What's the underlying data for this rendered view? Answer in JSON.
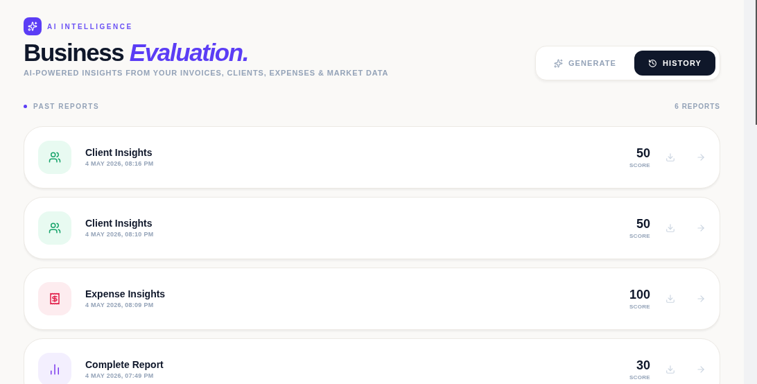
{
  "header": {
    "eyebrow": "AI INTELLIGENCE",
    "title": "Business",
    "title_accent": "Evaluation.",
    "subtitle": "AI-POWERED INSIGHTS FROM YOUR INVOICES, CLIENTS, EXPENSES & MARKET DATA"
  },
  "mode_toggle": [
    {
      "kind": "generate",
      "label": "GENERATE",
      "selected": false
    },
    {
      "kind": "history",
      "label": "HISTORY",
      "selected": true
    }
  ],
  "section": {
    "label": "PAST REPORTS",
    "count": "6 REPORTS"
  },
  "reports": [
    {
      "kind": "client",
      "title": "Client Insights",
      "date": "4 MAY 2026, 08:16 PM",
      "score": "50",
      "score_label": "SCORE"
    },
    {
      "kind": "client",
      "title": "Client Insights",
      "date": "4 MAY 2026, 08:10 PM",
      "score": "50",
      "score_label": "SCORE"
    },
    {
      "kind": "expense",
      "title": "Expense Insights",
      "date": "4 MAY 2026, 08:09 PM",
      "score": "100",
      "score_label": "SCORE"
    },
    {
      "kind": "complete",
      "title": "Complete Report",
      "date": "4 MAY 2026, 07:49 PM",
      "score": "30",
      "score_label": "SCORE"
    }
  ]
}
